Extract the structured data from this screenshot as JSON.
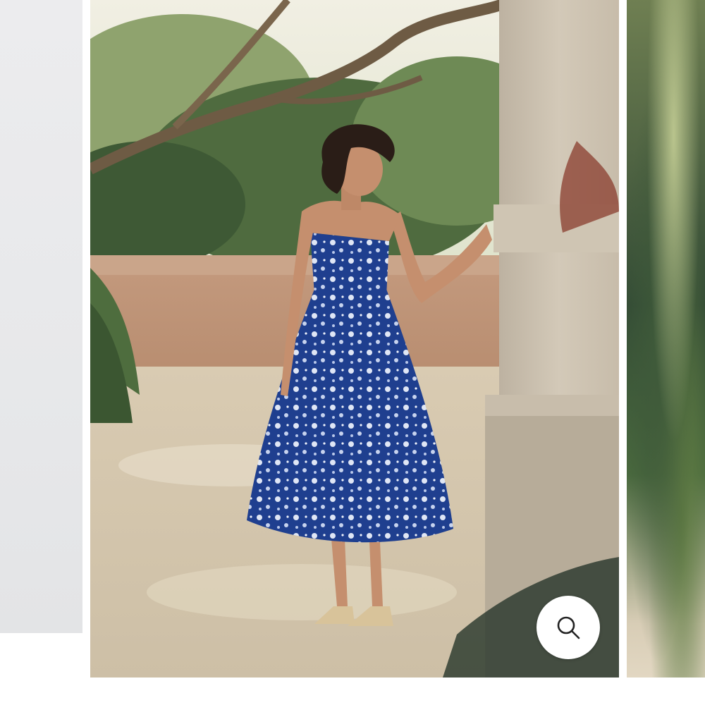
{
  "gallery": {
    "prev_slide": {},
    "main_image": {
      "alt": "",
      "dress_color": "#1f3f8f",
      "print_color": "#dfe6f5"
    },
    "next_slide": {},
    "zoom_button": {
      "icon": "magnifier-icon"
    }
  }
}
